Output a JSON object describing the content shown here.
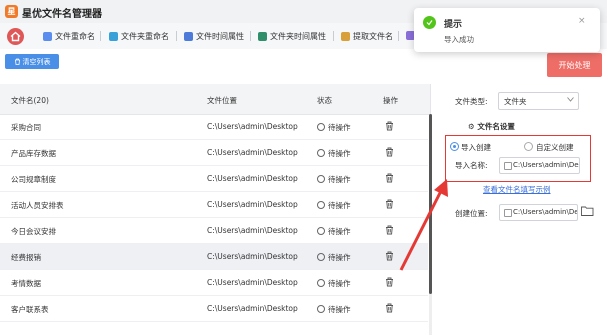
{
  "app": {
    "title": "星优文件名管理器",
    "logo_char": "星"
  },
  "nav": {
    "tabs": [
      {
        "label": "文件重命名",
        "icon": "rename-icon",
        "color": "#5b8def"
      },
      {
        "label": "文件夹重命名",
        "icon": "folder-rename-icon",
        "color": "#3aa0d8"
      },
      {
        "label": "文件时间属性",
        "icon": "file-time-icon",
        "color": "#4c7bd9"
      },
      {
        "label": "文件夹时间属性",
        "icon": "folder-time-icon",
        "color": "#2f8f6b"
      },
      {
        "label": "提取文件名",
        "icon": "extract-name-icon",
        "color": "#d9a03a"
      }
    ]
  },
  "toolbar": {
    "clear_label": "清空列表",
    "start_label": "开始处理"
  },
  "list": {
    "headers": {
      "name": "文件名(20)",
      "location": "文件位置",
      "status": "状态",
      "action": "操作"
    },
    "rows": [
      {
        "name": "采购合同",
        "location": "C:\\Users\\admin\\Desktop",
        "status": "待操作"
      },
      {
        "name": "产品库存数据",
        "location": "C:\\Users\\admin\\Desktop",
        "status": "待操作"
      },
      {
        "name": "公司规章制度",
        "location": "C:\\Users\\admin\\Desktop",
        "status": "待操作"
      },
      {
        "name": "活动人员安排表",
        "location": "C:\\Users\\admin\\Desktop",
        "status": "待操作"
      },
      {
        "name": "今日会议安排",
        "location": "C:\\Users\\admin\\Desktop",
        "status": "待操作"
      },
      {
        "name": "经费报销",
        "location": "C:\\Users\\admin\\Desktop",
        "status": "待操作"
      },
      {
        "name": "考情数据",
        "location": "C:\\Users\\admin\\Desktop",
        "status": "待操作"
      },
      {
        "name": "客户联系表",
        "location": "C:\\Users\\admin\\Desktop",
        "status": "待操作"
      }
    ]
  },
  "panel": {
    "file_type_label": "文件类型:",
    "file_type_value": "文件夹",
    "section_title": "文件名设置",
    "radio_import": "导入创建",
    "radio_custom": "自定义创建",
    "import_name_label": "导入名称:",
    "import_name_value": "C:\\Users\\admin\\Des",
    "example_link": "查看文件名填写示例",
    "create_location_label": "创建位置:",
    "create_location_value": "C:\\Users\\admin\\Des"
  },
  "toast": {
    "title": "提示",
    "message": "导入成功",
    "close": "×"
  },
  "colors": {
    "accent_blue": "#4a8fe7",
    "start_red": "#ee6d67",
    "annotation_red": "#e53935",
    "success_green": "#52c41a"
  }
}
